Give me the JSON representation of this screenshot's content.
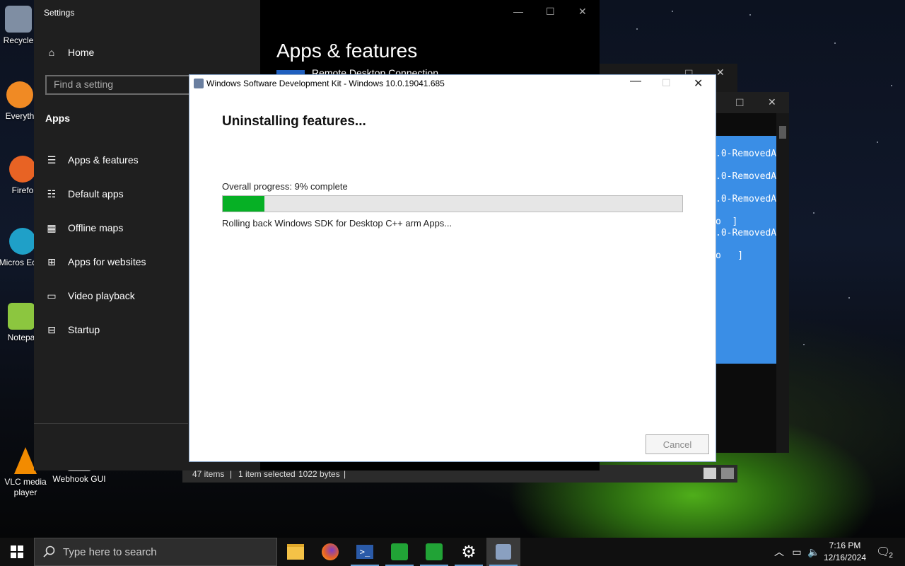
{
  "desktop_icons": [
    {
      "label": "Recycle"
    },
    {
      "label": "Everyth"
    },
    {
      "label": "Firefo"
    },
    {
      "label": "Micros Edge"
    },
    {
      "label": "Notepa"
    },
    {
      "label": "VLC media player"
    },
    {
      "label": "Webhook GUI"
    }
  ],
  "settings": {
    "title": "Settings",
    "home": "Home",
    "search_placeholder": "Find a setting",
    "section": "Apps",
    "nav": [
      {
        "label": "Apps & features",
        "icon": "list-icon"
      },
      {
        "label": "Default apps",
        "icon": "default-apps-icon"
      },
      {
        "label": "Offline maps",
        "icon": "map-icon"
      },
      {
        "label": "Apps for websites",
        "icon": "open-in-icon"
      },
      {
        "label": "Video playback",
        "icon": "video-icon"
      },
      {
        "label": "Startup",
        "icon": "startup-icon"
      }
    ],
    "page_title": "Apps & features",
    "visible_app": "Remote Desktop Connection"
  },
  "explorer_status": {
    "items": "47 items",
    "selected": "1 item selected",
    "size": "1022 bytes"
  },
  "console_lines": [
    ".0-RemovedA",
    ".0-RemovedA",
    ".0-RemovedA",
    "o  ]",
    ".0-RemovedA",
    "o   ]"
  ],
  "dialog": {
    "title": "Windows Software Development Kit - Windows 10.0.19041.685",
    "heading": "Uninstalling features...",
    "progress_label": "Overall progress: 9% complete",
    "progress_fraction": 0.09,
    "status": "Rolling back Windows SDK for Desktop C++ arm Apps...",
    "cancel": "Cancel",
    "accent": "#06b025"
  },
  "taskbar": {
    "search_placeholder": "Type here to search",
    "time": "7:16 PM",
    "date": "12/16/2024",
    "notifications": "2"
  }
}
